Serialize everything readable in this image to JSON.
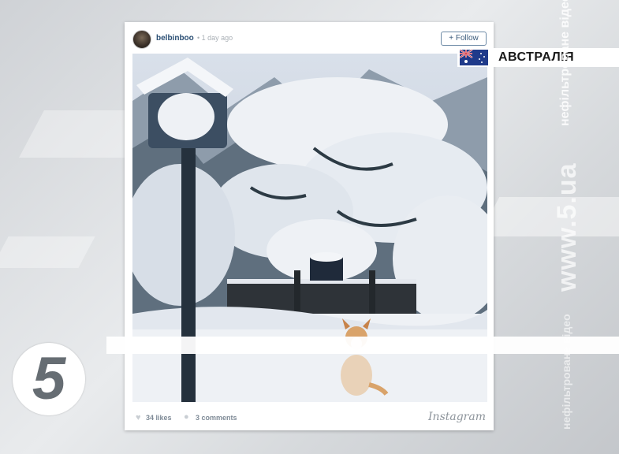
{
  "post": {
    "username": "belbinboo",
    "time_ago": "• 1 day ago",
    "follow_label": "+ Follow",
    "likes": "34 likes",
    "comments": "3 comments",
    "platform_logo": "Instagram",
    "icons": {
      "likes": "heart-icon",
      "comments": "comment-bubble-icon"
    }
  },
  "overlay": {
    "country": "АВСТРАЛІЯ",
    "flag": "australia-flag-icon",
    "vertical_tagline": "нефільтроване відео",
    "vertical_site": "www.5.ua",
    "vertical_tagline_2": "нефільтроване відео",
    "channel_logo": "5"
  },
  "colors": {
    "username": "#2b4f74",
    "follow_border": "#6d8aa6",
    "snow": "#eef1f5",
    "tree_dark": "#2c3a44"
  }
}
